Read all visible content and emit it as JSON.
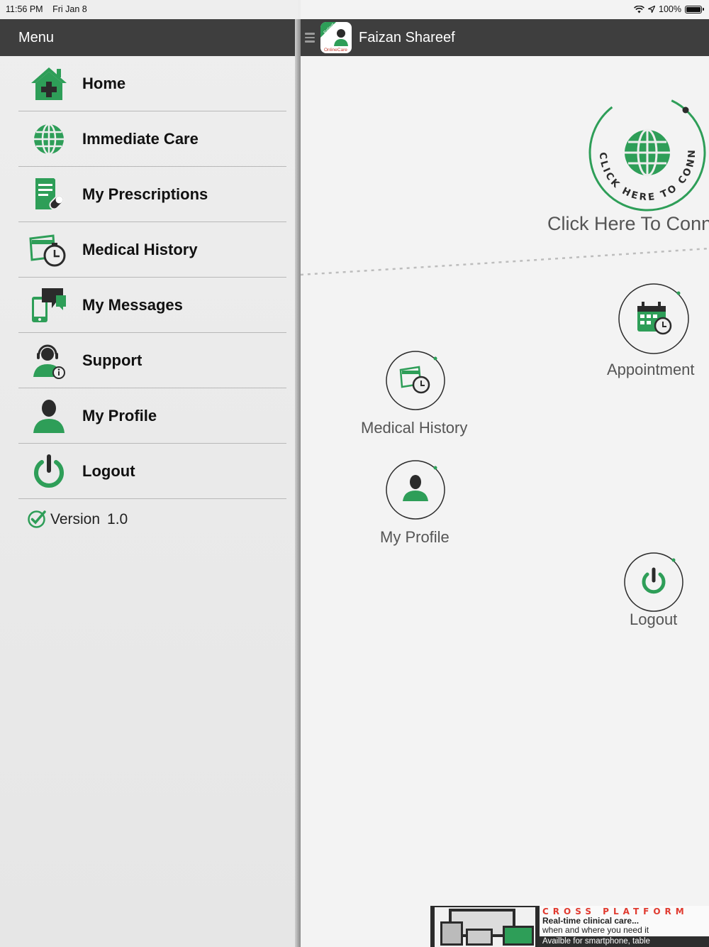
{
  "status_bar": {
    "time": "11:56 PM",
    "date": "Fri Jan 8",
    "battery": "100%",
    "icons": [
      "wifi-icon",
      "location-icon",
      "battery-icon"
    ]
  },
  "drawer": {
    "title": "Menu",
    "items": [
      {
        "label": "Home",
        "icon": "home-icon"
      },
      {
        "label": "Immediate Care",
        "icon": "globe-icon"
      },
      {
        "label": "My Prescriptions",
        "icon": "prescription-icon"
      },
      {
        "label": "Medical History",
        "icon": "medical-history-icon"
      },
      {
        "label": "My Messages",
        "icon": "messages-icon"
      },
      {
        "label": "Support",
        "icon": "support-icon"
      },
      {
        "label": "My Profile",
        "icon": "profile-icon"
      },
      {
        "label": "Logout",
        "icon": "power-icon"
      }
    ],
    "version_label": "Version",
    "version_number": "1.0"
  },
  "main": {
    "user_name": "Faizan Shareef",
    "logo_text": "OnlineCare",
    "logo_badge": "Patient",
    "connect_ring_text": "CLICK HERE TO CONNECT",
    "connect_label": "Click Here To Conn",
    "buttons": {
      "appointment": "Appointment",
      "medical_history": "Medical History",
      "my_profile": "My Profile",
      "logout": "Logout"
    }
  },
  "banner": {
    "title": "CROSS PLATFORM",
    "line1": "Real-time clinical care...",
    "line2": "when and where you need it",
    "footer": "Availble for smartphone, table"
  },
  "colors": {
    "accent_green": "#2e9e58",
    "header_dark": "#3e3e3e",
    "banner_red": "#e03a2f"
  }
}
